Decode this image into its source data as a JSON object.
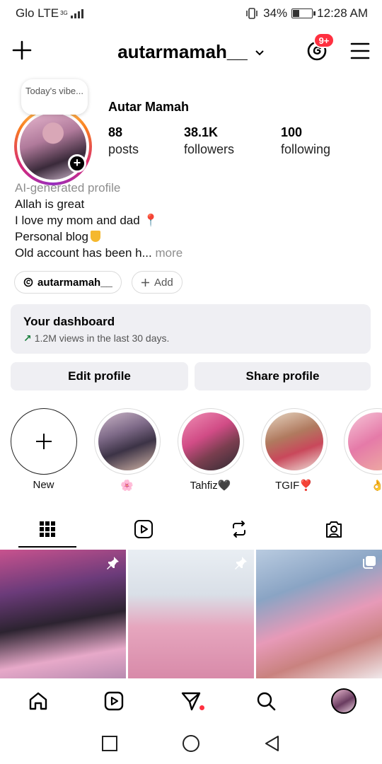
{
  "status_bar": {
    "carrier": "Glo LTE",
    "network_sup": "3G",
    "battery_percent": "34%",
    "battery_level": 0.34,
    "time": "12:28 AM"
  },
  "header": {
    "username": "autarmamah__",
    "notification_badge": "9+"
  },
  "profile": {
    "note": "Today's vibe...",
    "display_name": "Autar Mamah",
    "stats": [
      {
        "value": "88",
        "label": "posts"
      },
      {
        "value": "38.1K",
        "label": "followers"
      },
      {
        "value": "100",
        "label": "following"
      }
    ],
    "bio_label": "AI-generated profile",
    "bio_lines": [
      "Allah is great",
      "I love my mom and dad",
      "Personal blog",
      "Old account has been h..."
    ],
    "more_label": "more",
    "threads_handle": "autarmamah__",
    "add_chip_label": "Add"
  },
  "dashboard": {
    "title": "Your dashboard",
    "subtitle": "1.2M views in the last 30 days."
  },
  "buttons": {
    "edit_profile": "Edit profile",
    "share_profile": "Share profile"
  },
  "highlights": [
    {
      "label": "New"
    },
    {
      "label": "🌸"
    },
    {
      "label": "Tahfiz🖤"
    },
    {
      "label": "TGIF❣️"
    },
    {
      "label": "👌"
    }
  ],
  "colors": {
    "accent_red": "#ff3040",
    "button_bg": "#efeff3",
    "growth_green": "#1a7f3c"
  },
  "tabs": [
    {
      "icon": "grid-icon",
      "active": true
    },
    {
      "icon": "reels-icon",
      "active": false
    },
    {
      "icon": "reposts-icon",
      "active": false
    },
    {
      "icon": "tagged-icon",
      "active": false
    }
  ],
  "grid_items": [
    {
      "overlay_icon": "pin-icon"
    },
    {
      "overlay_icon": "pin-icon"
    },
    {
      "overlay_icon": "carousel-icon"
    }
  ],
  "bottom_nav": [
    "home-icon",
    "reels-icon",
    "direct-message-icon",
    "search-icon",
    "profile-avatar"
  ],
  "system_nav": [
    "recents-icon",
    "home-circle-icon",
    "back-icon"
  ]
}
